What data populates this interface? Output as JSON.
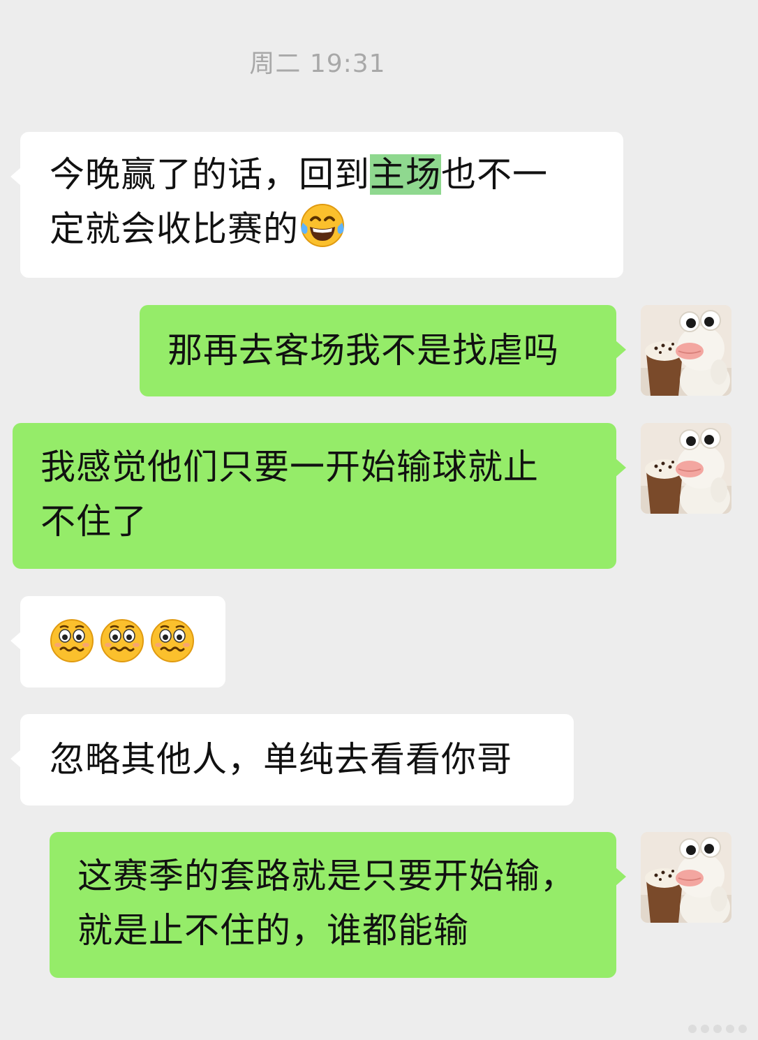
{
  "timestamp": "周二 19:31",
  "messages": [
    {
      "direction": "incoming",
      "text_before": "今晚赢了的话，回到",
      "text_highlight": "主场",
      "text_after": "也不一",
      "line2": "定就会收比赛的",
      "emoji": "tears-of-joy-icon"
    },
    {
      "direction": "outgoing",
      "text": "那再去客场我不是找虐吗"
    },
    {
      "direction": "outgoing",
      "line1": "我感觉他们只要一开始输球就止",
      "line2": "不住了"
    },
    {
      "direction": "incoming",
      "emojis": [
        "woozy-face-icon",
        "woozy-face-icon",
        "woozy-face-icon"
      ]
    },
    {
      "direction": "incoming",
      "text": "忽略其他人，单纯去看看你哥"
    },
    {
      "direction": "outgoing",
      "line1": "这赛季的套路就是只要开始输，",
      "line2": "就是止不住的，谁都能输"
    }
  ],
  "colors": {
    "background": "#ededed",
    "incoming_bubble": "#ffffff",
    "outgoing_bubble": "#95ec69",
    "highlight": "#8fd88f",
    "timestamp_text": "#a8a8a8"
  },
  "avatar": {
    "icon": "plush-toy-avatar-icon"
  }
}
